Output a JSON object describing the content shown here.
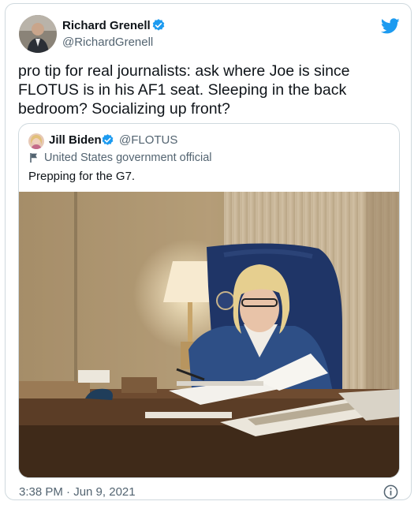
{
  "tweet": {
    "author_name": "Richard Grenell",
    "author_handle": "@RichardGrenell",
    "text": "pro tip for real journalists: ask where Joe is since\nFLOTUS is in his AF1 seat. Sleeping in the back\nbedroom? Socializing up front?",
    "timestamp": "3:38 PM · Jun 9, 2021",
    "icons": {
      "verified": "verified-badge-icon",
      "platform": "twitter-bird-icon",
      "info": "info-icon"
    },
    "colors": {
      "accent": "#1d9bf0",
      "text": "#0f1419",
      "secondary": "#536471",
      "border": "#cfd9de"
    }
  },
  "quote": {
    "author_name": "Jill Biden",
    "author_handle": "@FLOTUS",
    "label": "United States government official",
    "text": "Prepping for the G7.",
    "icons": {
      "verified": "verified-badge-icon",
      "flag": "flag-icon"
    }
  }
}
